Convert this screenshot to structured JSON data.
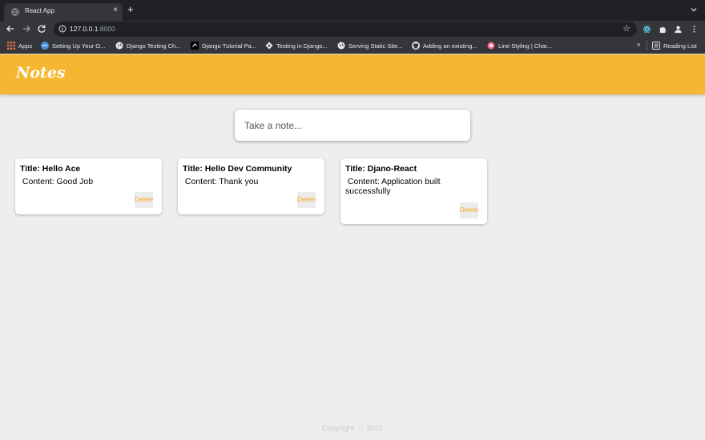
{
  "browser": {
    "tab_title": "React App",
    "tab_close": "×",
    "new_tab": "+",
    "url_host": "127.0.0.1",
    "url_port": ":8000",
    "star": "☆",
    "bookmarks": [
      {
        "label": "Apps",
        "icon": "apps-grid-icon"
      },
      {
        "label": "Setting Up Your O...",
        "icon": "site-icon"
      },
      {
        "label": "Django Testing Ch...",
        "icon": "globe-icon"
      },
      {
        "label": "Django Tutorial Pa...",
        "icon": "site-icon"
      },
      {
        "label": "Testing in Django...",
        "icon": "site-icon"
      },
      {
        "label": "Serving Static Site...",
        "icon": "globe-icon"
      },
      {
        "label": "Adding an existing...",
        "icon": "github-icon"
      },
      {
        "label": "Line Styling | Char...",
        "icon": "site-icon"
      }
    ],
    "more": "»",
    "reading_list": "Reading List"
  },
  "app": {
    "title": "Notes",
    "input_placeholder": "Take a note...",
    "notes": [
      {
        "title": "Title: Hello Ace",
        "content": "Content: Good Job",
        "delete_label": "Delete"
      },
      {
        "title": "Title: Hello Dev Community",
        "content": "Content: Thank you",
        "delete_label": "Delete"
      },
      {
        "title": "Title: Djano-React",
        "content": "Content: Application built successfully",
        "delete_label": "Delete"
      }
    ],
    "footer": "Copyright ⓒ 2021"
  },
  "colors": {
    "header": "#f5b731",
    "delete_text": "#f5a623",
    "background": "#eeeeee"
  }
}
